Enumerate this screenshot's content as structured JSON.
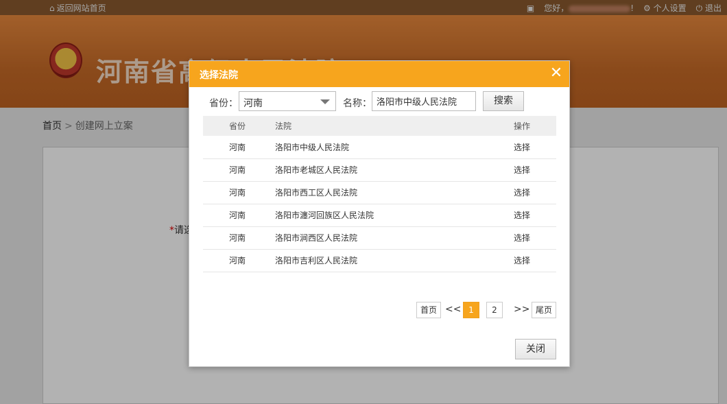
{
  "topbar": {
    "home_link": "返回网站首页",
    "greeting": "您好，",
    "greeting_suffix": "!",
    "settings": "个人设置",
    "logout": "退出"
  },
  "header": {
    "title": "河南省高级人民法院"
  },
  "breadcrumb": {
    "home": "首页",
    "separator": ">",
    "current": "创建网上立案"
  },
  "form": {
    "required_mark": "*",
    "required_label": "请选"
  },
  "dialog": {
    "title": "选择法院",
    "province_label": "省份：",
    "province_value": "河南",
    "name_label": "名称：",
    "name_value": "洛阳市中级人民法院",
    "search_button": "搜索",
    "columns": [
      "省份",
      "法院",
      "操作"
    ],
    "rows": [
      {
        "province": "河南",
        "court": "洛阳市中级人民法院",
        "action": "选择"
      },
      {
        "province": "河南",
        "court": "洛阳市老城区人民法院",
        "action": "选择"
      },
      {
        "province": "河南",
        "court": "洛阳市西工区人民法院",
        "action": "选择"
      },
      {
        "province": "河南",
        "court": "洛阳市瀍河回族区人民法院",
        "action": "选择"
      },
      {
        "province": "河南",
        "court": "洛阳市涧西区人民法院",
        "action": "选择"
      },
      {
        "province": "河南",
        "court": "洛阳市吉利区人民法院",
        "action": "选择"
      }
    ],
    "pager": {
      "first": "首页",
      "prev": "<<",
      "pages": [
        "1",
        "2"
      ],
      "current_page": "1",
      "next": ">>",
      "last": "尾页"
    },
    "close_button": "关闭"
  },
  "colors": {
    "accent": "#f7a51d",
    "header": "#c66a27",
    "topbar": "#8a5a2e"
  }
}
